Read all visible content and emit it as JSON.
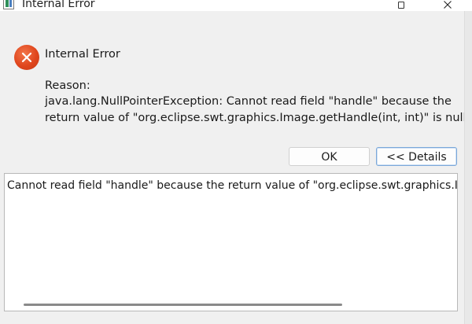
{
  "window": {
    "title": "Internal Error",
    "icons": {
      "app": "eclipse-app-icon",
      "maximize": "maximize-icon",
      "close": "close-icon"
    }
  },
  "message": {
    "icon": "error-icon",
    "icon_color": "#e0461d",
    "title": "Internal Error",
    "reason_label": "Reason:",
    "reason_lines": [
      "java.lang.NullPointerException: Cannot read field \"handle\" because the",
      "return value of \"org.eclipse.swt.graphics.Image.getHandle(int, int)\" is null"
    ]
  },
  "buttons": {
    "ok_label": "OK",
    "details_label": "<< Details"
  },
  "details": {
    "text": "Cannot read field \"handle\" because the return value of \"org.eclipse.swt.graphics.Image.getHandle(int, int)\" is null"
  }
}
